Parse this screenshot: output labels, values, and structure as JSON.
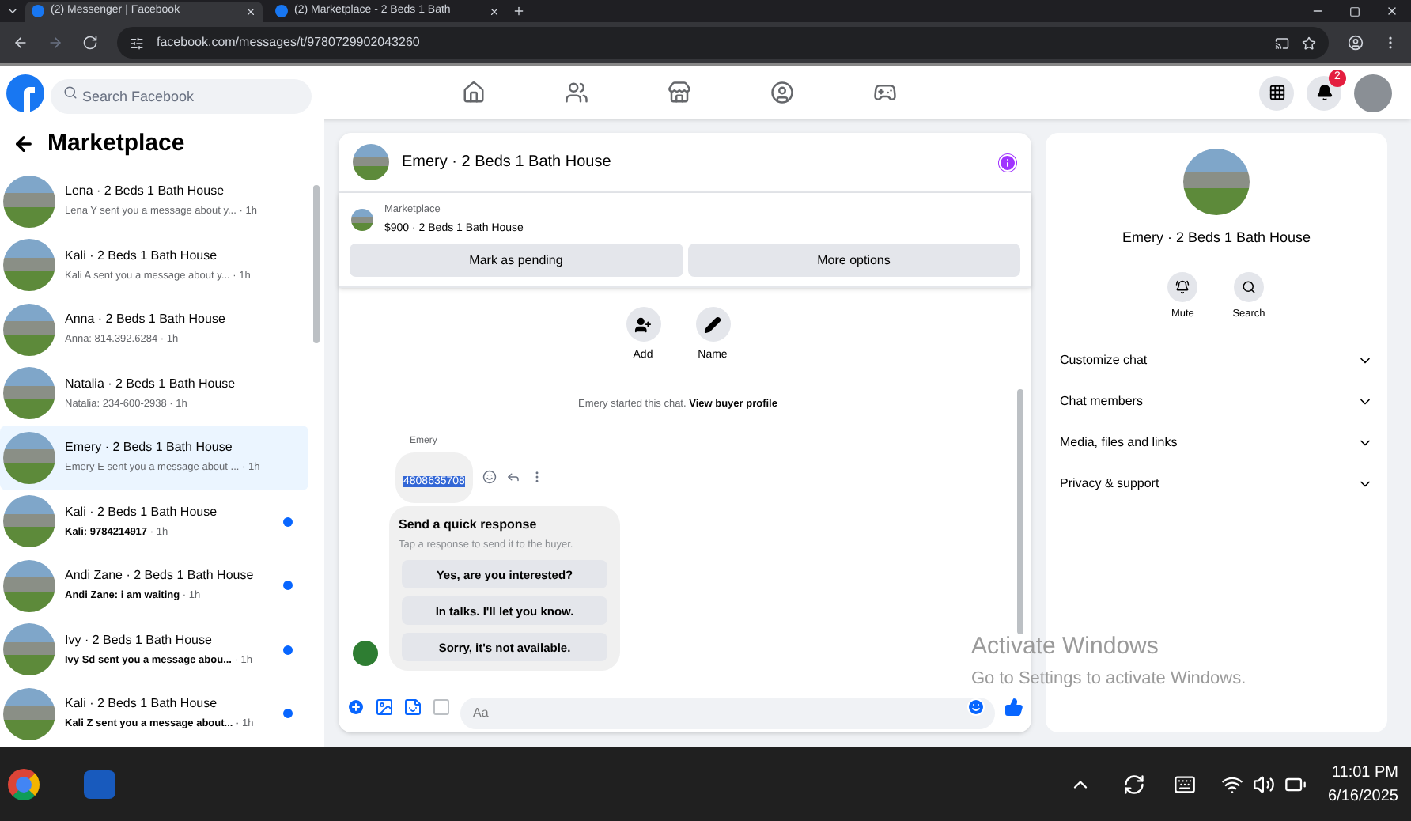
{
  "browser": {
    "tabs": [
      {
        "title": "(2) Messenger | Facebook",
        "selected": true
      },
      {
        "title": "(2) Marketplace - 2 Beds 1 Bath",
        "selected": false
      }
    ],
    "url": "facebook.com/messages/t/9780729902043260"
  },
  "header": {
    "search_placeholder": "Search Facebook",
    "notifications_badge": "2"
  },
  "sidebar": {
    "title": "Marketplace",
    "conversations": [
      {
        "title": "Lena · 2 Beds 1 Bath House",
        "preview": "Lena Y sent you a message about y...",
        "time": "· 1h",
        "selected": false,
        "unread": false
      },
      {
        "title": "Kali · 2 Beds 1 Bath House",
        "preview": "Kali A sent you a message about y...",
        "time": "· 1h",
        "selected": false,
        "unread": false
      },
      {
        "title": "Anna · 2 Beds 1 Bath House",
        "preview": "Anna: 814.392.6284",
        "time": "· 1h",
        "selected": false,
        "unread": false
      },
      {
        "title": "Natalia · 2 Beds 1 Bath House",
        "preview": "Natalia: 234-600-2938",
        "time": "· 1h",
        "selected": false,
        "unread": false
      },
      {
        "title": "Emery · 2 Beds 1 Bath House",
        "preview": "Emery E sent you a message about ...",
        "time": "· 1h",
        "selected": true,
        "unread": false
      },
      {
        "title": "Kali · 2 Beds 1 Bath House",
        "preview": "Kali: 9784214917",
        "time": "· 1h",
        "selected": false,
        "unread": true
      },
      {
        "title": "Andi Zane · 2 Beds 1 Bath House",
        "preview": "Andi Zane: i am waiting",
        "time": "· 1h",
        "selected": false,
        "unread": true
      },
      {
        "title": "Ivy · 2 Beds 1 Bath House",
        "preview": "Ivy Sd sent you a message abou...",
        "time": "· 1h",
        "selected": false,
        "unread": true
      },
      {
        "title": "Kali · 2 Beds 1 Bath House",
        "preview": "Kali Z sent you a message about...",
        "time": "· 1h",
        "selected": false,
        "unread": true
      }
    ]
  },
  "chat": {
    "title": "Emery · 2 Beds 1 Bath House",
    "listing": {
      "label": "Marketplace",
      "item": "$900 · 2 Beds 1 Bath House"
    },
    "buttons": [
      "Mark as pending",
      "More options"
    ],
    "actions": [
      {
        "kind": "add",
        "label": "Add"
      },
      {
        "kind": "name",
        "label": "Name"
      }
    ],
    "system_note": {
      "text": "Emery started this chat.",
      "link": "View buyer profile"
    },
    "message": {
      "sender": "Emery",
      "text": "4808635708"
    },
    "quick_response": {
      "title": "Send a quick response",
      "subtitle": "Tap a response to send it to the buyer.",
      "options": [
        "Yes, are you interested?",
        "In talks. I'll let you know.",
        "Sorry, it's not available."
      ]
    },
    "composer_placeholder": "Aa"
  },
  "details": {
    "title": "Emery · 2 Beds 1 Bath House",
    "actions": [
      {
        "kind": "mute",
        "label": "Mute"
      },
      {
        "kind": "search",
        "label": "Search"
      }
    ],
    "sections": [
      "Customize chat",
      "Chat members",
      "Media, files and links",
      "Privacy & support"
    ]
  },
  "activation": {
    "title": "Activate Windows",
    "subtitle": "Go to Settings to activate Windows."
  },
  "taskbar": {
    "time": "11:01 PM",
    "date": "6/16/2025"
  }
}
